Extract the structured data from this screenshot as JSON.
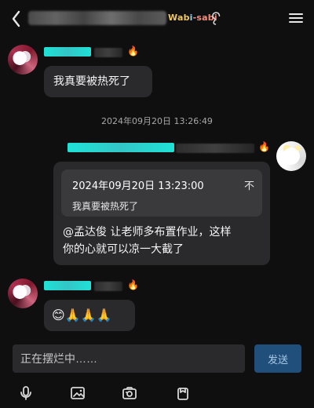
{
  "topbar": {
    "brand_parts": [
      "Wab",
      "i",
      "-sabi"
    ]
  },
  "messages": [
    {
      "text": "我真要被热死了"
    },
    {
      "timestamp": "2024年09月20日 13:26:49"
    },
    {
      "reply_quote": {
        "time": "2024年09月20日 13:23:00",
        "text": "我真要被热死了",
        "close_glyph": "不"
      },
      "text_line1": "@孟达俊 让老师多布置作业，这样",
      "text_line2": "你的心就可以凉一大截了"
    },
    {
      "emoji_text": "😊🙏🙏🙏"
    }
  ],
  "composer": {
    "placeholder": "正在摆烂中……",
    "send_label": "发送"
  },
  "icons": {
    "back": "chevron-left-icon",
    "menu": "menu-icon",
    "ear": "ear-icon",
    "mic": "mic-icon",
    "image": "image-icon",
    "camera": "camera-icon",
    "gift": "gift-icon"
  },
  "colors": {
    "background": "#0f0f10",
    "bubble": "#2a2a2d",
    "quote": "#3a3a3d",
    "send_bg": "#1f4f7a",
    "send_text": "#a9c7e6",
    "name_tag": "#1fe2d7"
  }
}
